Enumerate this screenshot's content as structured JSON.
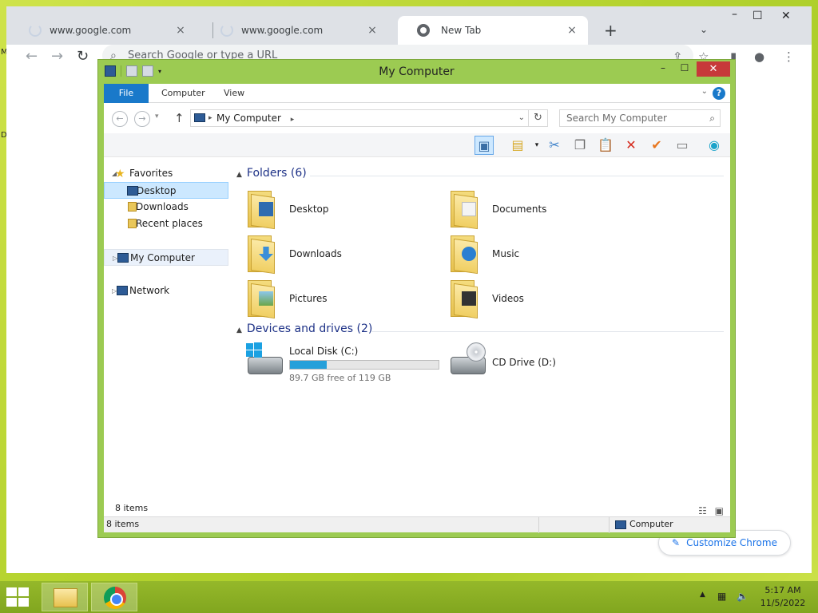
{
  "desktop": {
    "fragment_m": "M",
    "fragment_d": "D"
  },
  "chrome": {
    "tabs": [
      {
        "title": "www.google.com",
        "close": "×"
      },
      {
        "title": "www.google.com",
        "close": "×"
      },
      {
        "title": "New Tab",
        "close": "×"
      }
    ],
    "new_tab": "+",
    "tab_search": "⌄",
    "omnibox_placeholder": "Search Google or type a URL",
    "customize_label": "Customize Chrome"
  },
  "explorer": {
    "title": "My Computer",
    "ribbon_tabs": {
      "file": "File",
      "computer": "Computer",
      "view": "View"
    },
    "help": "?",
    "address": "My Computer",
    "search_placeholder": "Search My Computer",
    "nav": {
      "favorites": "Favorites",
      "desktop": "Desktop",
      "downloads": "Downloads",
      "recent": "Recent places",
      "computer": "My Computer",
      "network": "Network"
    },
    "folders_header": "Folders (6)",
    "folders": [
      "Desktop",
      "Documents",
      "Downloads",
      "Music",
      "Pictures",
      "Videos"
    ],
    "devices_header": "Devices and drives (2)",
    "drives": {
      "c_name": "Local Disk (C:)",
      "c_free": "89.7 GB free of 119 GB",
      "c_used_fraction": 0.246,
      "d_name": "CD Drive (D:)"
    },
    "items_inner": "8 items",
    "status_left": "8 items",
    "status_right": "Computer"
  },
  "taskbar": {
    "time": "5:17 AM",
    "date": "11/5/2022"
  },
  "colors": {
    "window_frame": "#9ccb52",
    "file_tab": "#1979ca",
    "close_button": "#c7393a",
    "usage_fill": "#26a0da"
  }
}
